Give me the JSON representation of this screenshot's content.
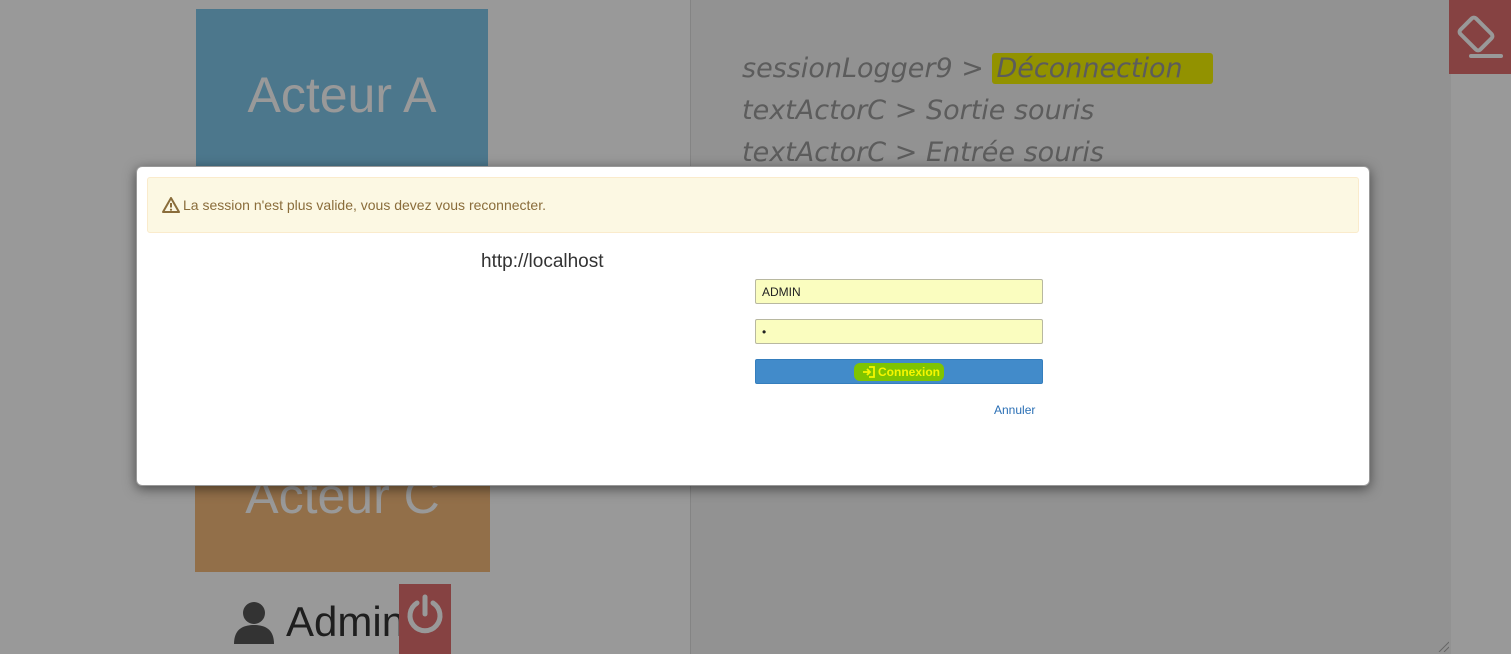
{
  "background": {
    "actor_a_label": "Acteur A",
    "actor_c_label": "Acteur C",
    "user_name": "Admin",
    "log_entries": [
      {
        "source": "sessionLogger9",
        "sep": " > ",
        "event": "Déconnection"
      },
      {
        "source": "textActorC",
        "sep": " > ",
        "event": "Sortie souris"
      },
      {
        "source": "textActorC",
        "sep": " > ",
        "event": "Entrée souris"
      }
    ],
    "colors": {
      "actor_a": "#7fc6ea",
      "actor_c": "#f4b97a",
      "danger": "#e06f6f"
    },
    "icons": {
      "user": "user-icon",
      "power": "power-icon",
      "eraser": "eraser-icon"
    }
  },
  "modal": {
    "alert_text": "La session n'est plus valide, vous devez vous reconnecter.",
    "host": "http://localhost",
    "username_value": "ADMIN",
    "password_value": "•",
    "login_label": "Connexion",
    "cancel_label": "Annuler",
    "icons": {
      "alert": "warning-icon",
      "login": "sign-in-icon"
    }
  }
}
